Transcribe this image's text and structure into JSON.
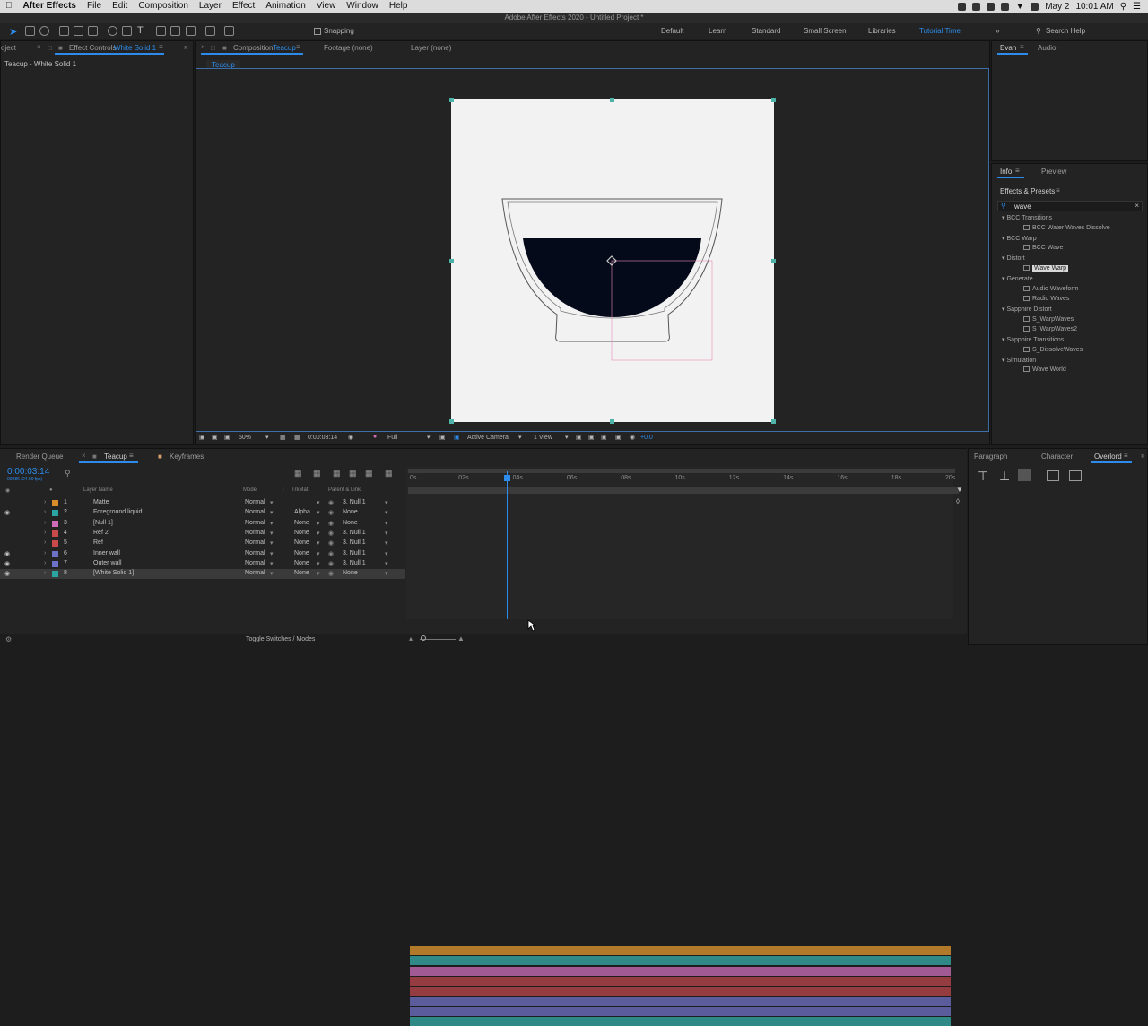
{
  "menubar": {
    "app": "After Effects",
    "items": [
      "File",
      "Edit",
      "Composition",
      "Layer",
      "Effect",
      "Animation",
      "View",
      "Window",
      "Help"
    ],
    "date": "May 2",
    "time": "10:01 AM"
  },
  "titlebar": {
    "title": "Adobe After Effects 2020 - Untitled Project *"
  },
  "toolbar": {
    "snapping": "Snapping",
    "workspaces": [
      "Default",
      "Learn",
      "Standard",
      "Small Screen",
      "Libraries",
      "Tutorial Time"
    ],
    "active_workspace": "Tutorial Time",
    "search": "Search Help"
  },
  "left_panel": {
    "tab_project": "oject",
    "tab_effect_controls": "Effect Controls",
    "effect_target": "White Solid 1",
    "subtitle": "Teacup - White Solid 1"
  },
  "viewer": {
    "tab_comp_prefix": "Composition",
    "tab_comp_name": "Teacup",
    "tab_footage": "Footage (none)",
    "tab_layer": "Layer (none)",
    "comp_chip": "Teacup",
    "zoom": "50%",
    "timecode": "0:00:03:14",
    "resolution": "Full",
    "camera": "Active Camera",
    "view": "1 View",
    "exposure": "+0.0"
  },
  "right_panel": {
    "user": "Evan",
    "audio": "Audio",
    "info": "Info",
    "preview": "Preview",
    "effects_title": "Effects & Presets",
    "search_value": "wave",
    "tree": [
      {
        "cat": "BCC Transitions",
        "items": [
          "BCC Water Waves Dissolve"
        ]
      },
      {
        "cat": "BCC Warp",
        "items": [
          "BCC Wave"
        ]
      },
      {
        "cat": "Distort",
        "items": [
          "Wave Warp"
        ]
      },
      {
        "cat": "Generate",
        "items": [
          "Audio Waveform",
          "Radio Waves"
        ]
      },
      {
        "cat": "Sapphire Distort",
        "items": [
          "S_WarpWaves",
          "S_WarpWaves2"
        ]
      },
      {
        "cat": "Sapphire Transitions",
        "items": [
          "S_DissolveWaves"
        ]
      },
      {
        "cat": "Simulation",
        "items": [
          "Wave World"
        ]
      }
    ],
    "highlighted": "Wave Warp"
  },
  "bottom_right": {
    "tabs": [
      "Paragraph",
      "Character",
      "Overlord"
    ]
  },
  "timeline": {
    "tab_render": "Render Queue",
    "tab_comp": "Teacup",
    "tab_keyframes": "Keyframes",
    "timecode": "0:00:03:14",
    "frames": "00086 (24.00 fps)",
    "headers": {
      "layer_name": "Layer Name",
      "mode": "Mode",
      "t": "T",
      "trkmat": "TrkMat",
      "parent": "Parent & Link"
    },
    "ticks": [
      "0s",
      "02s",
      "04s",
      "06s",
      "08s",
      "10s",
      "12s",
      "14s",
      "16s",
      "18s",
      "20s"
    ],
    "playhead_seconds": 3.58,
    "duration_seconds": 20,
    "layers": [
      {
        "num": "1",
        "name": "Matte",
        "mode": "Normal",
        "trkmat": "",
        "parent": "3. Null 1",
        "label": "#d88d2b",
        "bar": "#b07a2a",
        "eye": false
      },
      {
        "num": "2",
        "name": "Foreground liquid",
        "mode": "Normal",
        "trkmat": "Alpha",
        "parent": "None",
        "label": "#2aa4a0",
        "bar": "#2f8a87",
        "eye": true
      },
      {
        "num": "3",
        "name": "[Null 1]",
        "mode": "Normal",
        "trkmat": "None",
        "parent": "None",
        "label": "#d06bb8",
        "bar": "#a25a95",
        "eye": false
      },
      {
        "num": "4",
        "name": "Ref 2",
        "mode": "Normal",
        "trkmat": "None",
        "parent": "3. Null 1",
        "label": "#c94a4a",
        "bar": "#943c40",
        "eye": false
      },
      {
        "num": "5",
        "name": "Ref",
        "mode": "Normal",
        "trkmat": "None",
        "parent": "3. Null 1",
        "label": "#c94a4a",
        "bar": "#943c40",
        "eye": false
      },
      {
        "num": "6",
        "name": "Inner wall",
        "mode": "Normal",
        "trkmat": "None",
        "parent": "3. Null 1",
        "label": "#6d72c8",
        "bar": "#5a5c9c",
        "eye": true
      },
      {
        "num": "7",
        "name": "Outer wall",
        "mode": "Normal",
        "trkmat": "None",
        "parent": "3. Null 1",
        "label": "#6d72c8",
        "bar": "#5a5c9c",
        "eye": true
      },
      {
        "num": "8",
        "name": "[White Solid 1]",
        "mode": "Normal",
        "trkmat": "None",
        "parent": "None",
        "label": "#2aa4a0",
        "bar": "#2f8a87",
        "eye": true
      }
    ],
    "toggle": "Toggle Switches / Modes"
  }
}
